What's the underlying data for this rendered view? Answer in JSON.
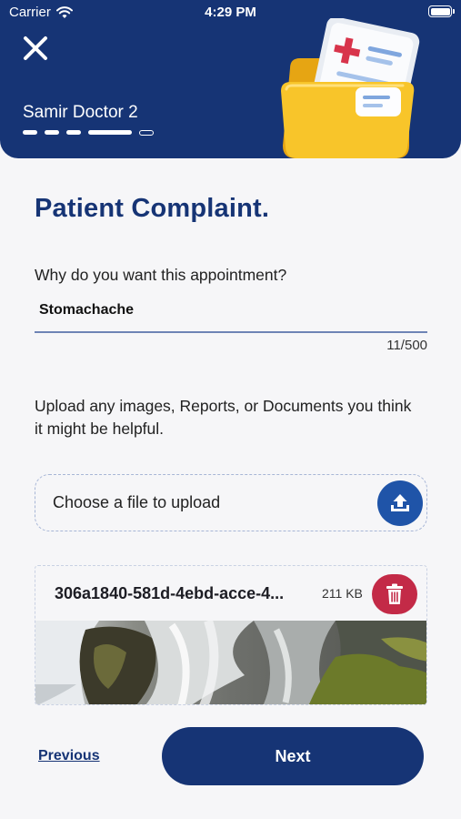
{
  "status_bar": {
    "carrier": "Carrier",
    "time": "4:29 PM"
  },
  "header": {
    "doctor_name": "Samir Doctor 2",
    "progress": {
      "completed_steps": 4,
      "total_steps": 5
    },
    "background_color": "#163475"
  },
  "form": {
    "title": "Patient Complaint.",
    "question_label": "Why do you want this appointment?",
    "answer_value": "Stomachache",
    "char_counter": "11/500",
    "upload_instructions": "Upload any images, Reports, or Documents you think it might be helpful.",
    "upload_placeholder": "Choose a file to upload"
  },
  "attachment": {
    "file_name": "306a1840-581d-4ebd-acce-4...",
    "file_size": "211 KB"
  },
  "footer": {
    "previous_label": "Previous",
    "next_label": "Next"
  },
  "colors": {
    "primary": "#163475",
    "upload_button": "#1f54a8",
    "delete_button": "#c32a47"
  },
  "icons": [
    "close-icon",
    "wifi-icon",
    "battery-icon",
    "upload-icon",
    "trash-icon",
    "medical-folder-illustration"
  ]
}
